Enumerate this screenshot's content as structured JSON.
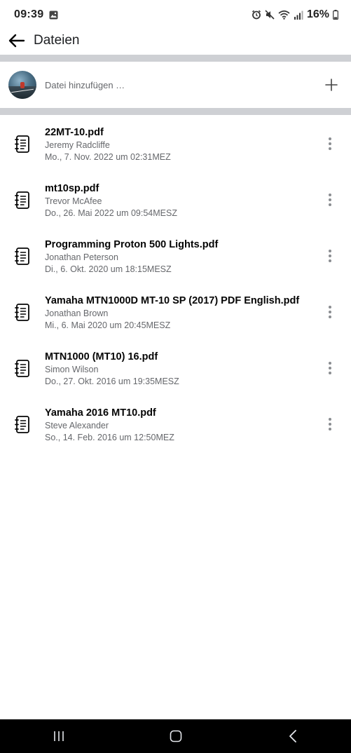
{
  "status_bar": {
    "time": "09:39",
    "battery": "16%",
    "icons": [
      "image-icon",
      "alarm-icon",
      "mute-icon",
      "wifi-icon",
      "signal-icon",
      "battery-icon"
    ]
  },
  "app_bar": {
    "title": "Dateien",
    "back_icon": "arrow-left-icon"
  },
  "add_file": {
    "placeholder": "Datei hinzufügen …",
    "plus_icon": "plus-icon"
  },
  "files": [
    {
      "name": "22MT-10.pdf",
      "author": "Jeremy Radcliffe",
      "date": "Mo., 7. Nov. 2022 um 02:31MEZ"
    },
    {
      "name": "mt10sp.pdf",
      "author": "Trevor McAfee",
      "date": "Do., 26. Mai 2022 um 09:54MESZ"
    },
    {
      "name": "Programming Proton 500 Lights.pdf",
      "author": "Jonathan Peterson",
      "date": "Di., 6. Okt. 2020 um 18:15MESZ"
    },
    {
      "name": "Yamaha MTN1000D MT-10 SP (2017) PDF English.pdf",
      "author": "Jonathan Brown",
      "date": "Mi., 6. Mai 2020 um 20:45MESZ"
    },
    {
      "name": "MTN1000 (MT10) 16.pdf",
      "author": "Simon Wilson",
      "date": "Do., 27. Okt. 2016 um 19:35MESZ"
    },
    {
      "name": "Yamaha 2016 MT10.pdf",
      "author": "Steve Alexander",
      "date": "So., 14. Feb. 2016 um 12:50MEZ"
    }
  ],
  "colors": {
    "divider": "#ced0d4",
    "secondary_text": "#65676b",
    "nav_bar": "#000000"
  }
}
